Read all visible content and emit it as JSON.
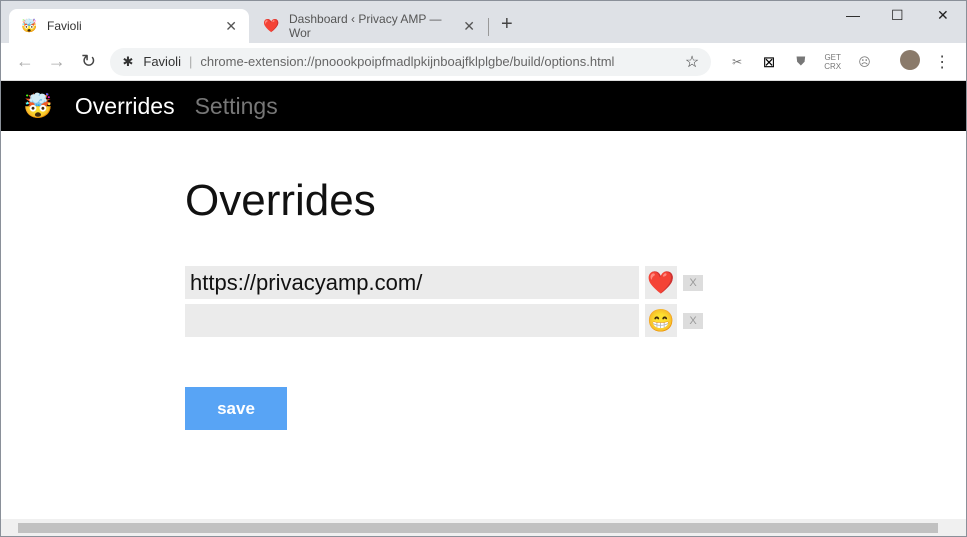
{
  "tabs": [
    {
      "title": "Favioli",
      "icon": "🤯"
    },
    {
      "title": "Dashboard ‹ Privacy AMP — Wor",
      "icon": "❤️"
    }
  ],
  "omnibox": {
    "site": "Favioli",
    "url": "chrome-extension://pnoookpoipfmadlpkijnboajfklplgbe/build/options.html"
  },
  "extensions": {
    "getcrx": "GET CRX"
  },
  "app": {
    "logo": "🤯",
    "nav": [
      "Overrides",
      "Settings"
    ]
  },
  "page": {
    "title": "Overrides",
    "rows": [
      {
        "value": "https://privacyamp.com/",
        "emoji": "❤️",
        "delete": "X"
      },
      {
        "value": "",
        "emoji": "😁",
        "delete": "X"
      }
    ],
    "save": "save"
  }
}
